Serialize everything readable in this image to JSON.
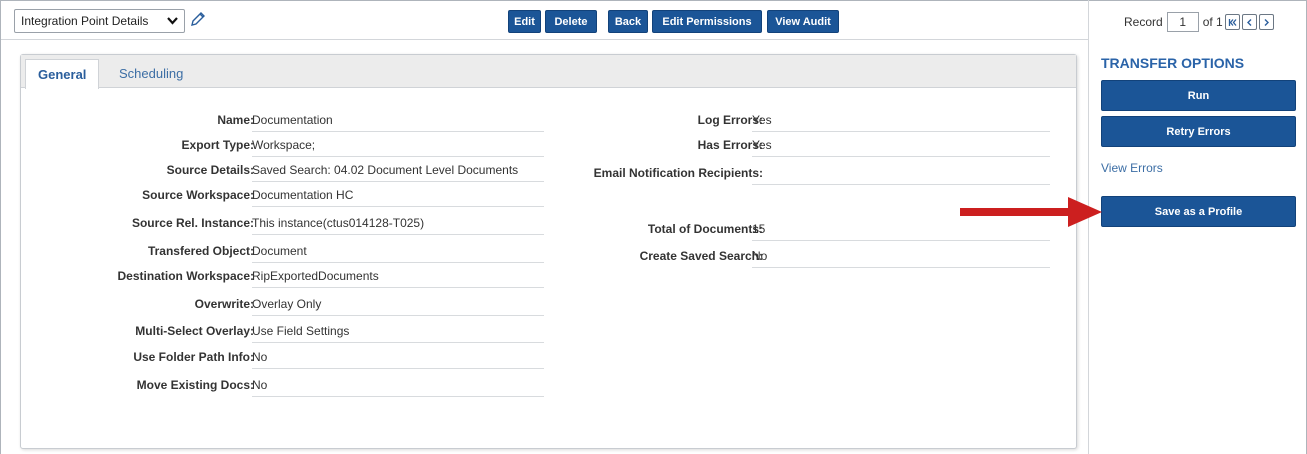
{
  "toolbar": {
    "view_select": "Integration Point Details",
    "buttons": {
      "edit": "Edit",
      "delete": "Delete",
      "back": "Back",
      "edit_permissions": "Edit Permissions",
      "view_audit": "View Audit"
    },
    "record": {
      "label": "Record",
      "current": "1",
      "of": "of 1"
    }
  },
  "tabs": {
    "general": "General",
    "scheduling": "Scheduling"
  },
  "left_fields": [
    {
      "label": "Name:",
      "value": "Documentation"
    },
    {
      "label": "Export Type:",
      "value": "Workspace;"
    },
    {
      "label": "Source Details:",
      "value": "Saved Search: 04.02 Document Level Documents"
    },
    {
      "label": "Source Workspace:",
      "value": "Documentation HC"
    },
    {
      "label": "Source Rel. Instance:",
      "value": "This instance(ctus014128-T025)"
    },
    {
      "label": "Transfered Object:",
      "value": "Document"
    },
    {
      "label": "Destination Workspace:",
      "value": "RipExportedDocuments"
    },
    {
      "label": "Overwrite:",
      "value": "Overlay Only"
    },
    {
      "label": "Multi-Select Overlay:",
      "value": "Use Field Settings"
    },
    {
      "label": "Use Folder Path Info:",
      "value": "No"
    },
    {
      "label": "Move Existing Docs:",
      "value": "No"
    }
  ],
  "right_fields": [
    {
      "label": "Log Errors:",
      "value": "Yes"
    },
    {
      "label": "Has Errors:",
      "value": "Yes"
    },
    {
      "label": "Email Notification Recipients:",
      "value": ""
    },
    {
      "label": "Total of Documents:",
      "value": "15"
    },
    {
      "label": "Create Saved Search:",
      "value": "No"
    }
  ],
  "transfer_options": {
    "title": "TRANSFER OPTIONS",
    "run": "Run",
    "retry_errors": "Retry Errors",
    "view_errors": "View Errors",
    "save_as_profile": "Save as a Profile"
  },
  "colors": {
    "button": "#1b5597",
    "link": "#3c6ea5",
    "arrow": "#cc1f1f"
  }
}
